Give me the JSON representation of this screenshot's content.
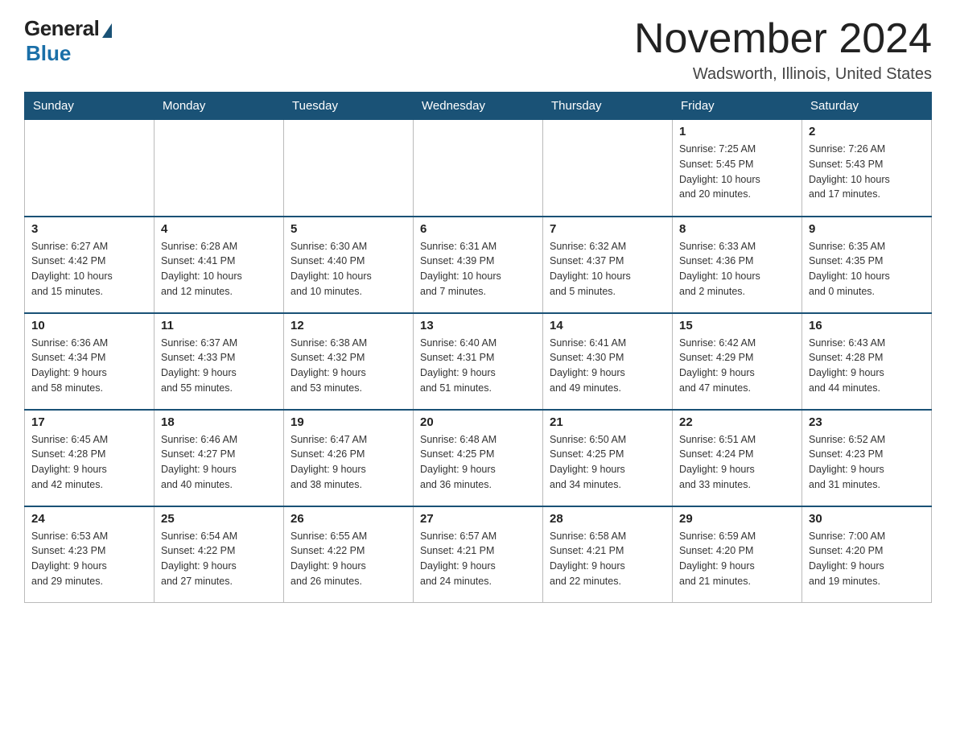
{
  "logo": {
    "general": "General",
    "blue": "Blue"
  },
  "title": "November 2024",
  "location": "Wadsworth, Illinois, United States",
  "days_of_week": [
    "Sunday",
    "Monday",
    "Tuesday",
    "Wednesday",
    "Thursday",
    "Friday",
    "Saturday"
  ],
  "weeks": [
    [
      {
        "num": "",
        "info": ""
      },
      {
        "num": "",
        "info": ""
      },
      {
        "num": "",
        "info": ""
      },
      {
        "num": "",
        "info": ""
      },
      {
        "num": "",
        "info": ""
      },
      {
        "num": "1",
        "info": "Sunrise: 7:25 AM\nSunset: 5:45 PM\nDaylight: 10 hours\nand 20 minutes."
      },
      {
        "num": "2",
        "info": "Sunrise: 7:26 AM\nSunset: 5:43 PM\nDaylight: 10 hours\nand 17 minutes."
      }
    ],
    [
      {
        "num": "3",
        "info": "Sunrise: 6:27 AM\nSunset: 4:42 PM\nDaylight: 10 hours\nand 15 minutes."
      },
      {
        "num": "4",
        "info": "Sunrise: 6:28 AM\nSunset: 4:41 PM\nDaylight: 10 hours\nand 12 minutes."
      },
      {
        "num": "5",
        "info": "Sunrise: 6:30 AM\nSunset: 4:40 PM\nDaylight: 10 hours\nand 10 minutes."
      },
      {
        "num": "6",
        "info": "Sunrise: 6:31 AM\nSunset: 4:39 PM\nDaylight: 10 hours\nand 7 minutes."
      },
      {
        "num": "7",
        "info": "Sunrise: 6:32 AM\nSunset: 4:37 PM\nDaylight: 10 hours\nand 5 minutes."
      },
      {
        "num": "8",
        "info": "Sunrise: 6:33 AM\nSunset: 4:36 PM\nDaylight: 10 hours\nand 2 minutes."
      },
      {
        "num": "9",
        "info": "Sunrise: 6:35 AM\nSunset: 4:35 PM\nDaylight: 10 hours\nand 0 minutes."
      }
    ],
    [
      {
        "num": "10",
        "info": "Sunrise: 6:36 AM\nSunset: 4:34 PM\nDaylight: 9 hours\nand 58 minutes."
      },
      {
        "num": "11",
        "info": "Sunrise: 6:37 AM\nSunset: 4:33 PM\nDaylight: 9 hours\nand 55 minutes."
      },
      {
        "num": "12",
        "info": "Sunrise: 6:38 AM\nSunset: 4:32 PM\nDaylight: 9 hours\nand 53 minutes."
      },
      {
        "num": "13",
        "info": "Sunrise: 6:40 AM\nSunset: 4:31 PM\nDaylight: 9 hours\nand 51 minutes."
      },
      {
        "num": "14",
        "info": "Sunrise: 6:41 AM\nSunset: 4:30 PM\nDaylight: 9 hours\nand 49 minutes."
      },
      {
        "num": "15",
        "info": "Sunrise: 6:42 AM\nSunset: 4:29 PM\nDaylight: 9 hours\nand 47 minutes."
      },
      {
        "num": "16",
        "info": "Sunrise: 6:43 AM\nSunset: 4:28 PM\nDaylight: 9 hours\nand 44 minutes."
      }
    ],
    [
      {
        "num": "17",
        "info": "Sunrise: 6:45 AM\nSunset: 4:28 PM\nDaylight: 9 hours\nand 42 minutes."
      },
      {
        "num": "18",
        "info": "Sunrise: 6:46 AM\nSunset: 4:27 PM\nDaylight: 9 hours\nand 40 minutes."
      },
      {
        "num": "19",
        "info": "Sunrise: 6:47 AM\nSunset: 4:26 PM\nDaylight: 9 hours\nand 38 minutes."
      },
      {
        "num": "20",
        "info": "Sunrise: 6:48 AM\nSunset: 4:25 PM\nDaylight: 9 hours\nand 36 minutes."
      },
      {
        "num": "21",
        "info": "Sunrise: 6:50 AM\nSunset: 4:25 PM\nDaylight: 9 hours\nand 34 minutes."
      },
      {
        "num": "22",
        "info": "Sunrise: 6:51 AM\nSunset: 4:24 PM\nDaylight: 9 hours\nand 33 minutes."
      },
      {
        "num": "23",
        "info": "Sunrise: 6:52 AM\nSunset: 4:23 PM\nDaylight: 9 hours\nand 31 minutes."
      }
    ],
    [
      {
        "num": "24",
        "info": "Sunrise: 6:53 AM\nSunset: 4:23 PM\nDaylight: 9 hours\nand 29 minutes."
      },
      {
        "num": "25",
        "info": "Sunrise: 6:54 AM\nSunset: 4:22 PM\nDaylight: 9 hours\nand 27 minutes."
      },
      {
        "num": "26",
        "info": "Sunrise: 6:55 AM\nSunset: 4:22 PM\nDaylight: 9 hours\nand 26 minutes."
      },
      {
        "num": "27",
        "info": "Sunrise: 6:57 AM\nSunset: 4:21 PM\nDaylight: 9 hours\nand 24 minutes."
      },
      {
        "num": "28",
        "info": "Sunrise: 6:58 AM\nSunset: 4:21 PM\nDaylight: 9 hours\nand 22 minutes."
      },
      {
        "num": "29",
        "info": "Sunrise: 6:59 AM\nSunset: 4:20 PM\nDaylight: 9 hours\nand 21 minutes."
      },
      {
        "num": "30",
        "info": "Sunrise: 7:00 AM\nSunset: 4:20 PM\nDaylight: 9 hours\nand 19 minutes."
      }
    ]
  ]
}
